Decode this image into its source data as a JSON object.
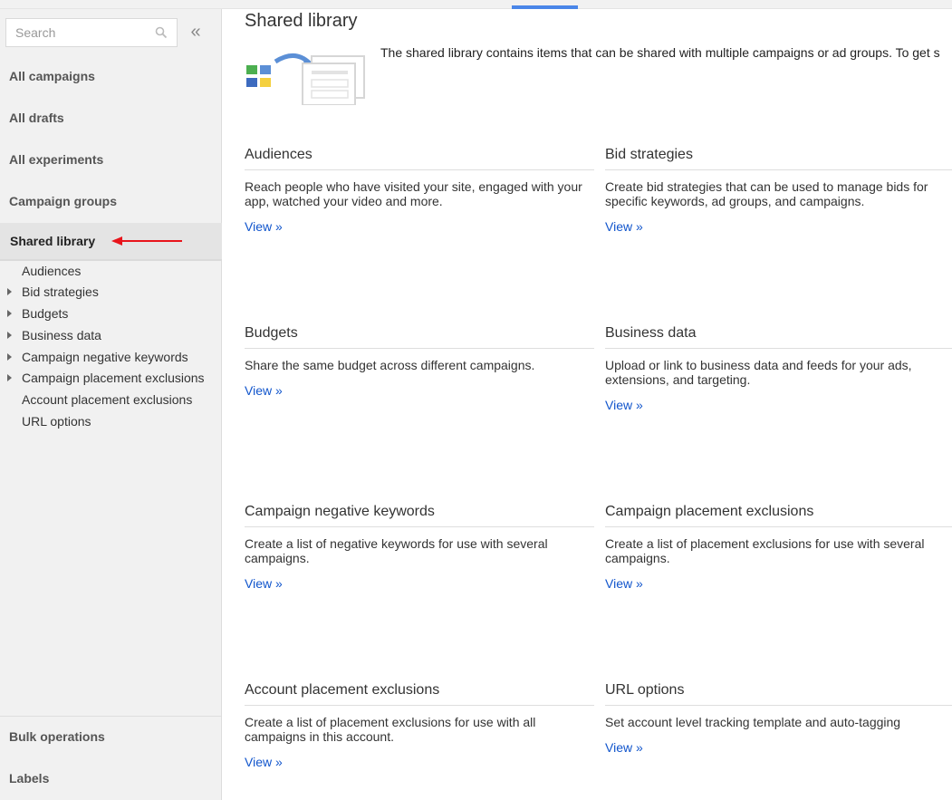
{
  "sidebar": {
    "search_placeholder": "Search",
    "collapse_label": "«",
    "nav": {
      "all_campaigns": "All campaigns",
      "all_drafts": "All drafts",
      "all_experiments": "All experiments",
      "campaign_groups": "Campaign groups",
      "shared_library": "Shared library",
      "bulk_operations": "Bulk operations",
      "labels": "Labels"
    },
    "sub_items": [
      {
        "label": "Audiences",
        "expandable": false
      },
      {
        "label": "Bid strategies",
        "expandable": true
      },
      {
        "label": "Budgets",
        "expandable": true
      },
      {
        "label": "Business data",
        "expandable": true
      },
      {
        "label": "Campaign negative keywords",
        "expandable": true
      },
      {
        "label": "Campaign placement exclusions",
        "expandable": true
      },
      {
        "label": "Account placement exclusions",
        "expandable": false
      },
      {
        "label": "URL options",
        "expandable": false
      }
    ]
  },
  "main": {
    "title": "Shared library",
    "intro": "The shared library contains items that can be shared with multiple campaigns or ad groups. To get s",
    "cards": [
      {
        "title": "Audiences",
        "desc": "Reach people who have visited your site, engaged with your app, watched your video and more.",
        "link": "View »"
      },
      {
        "title": "Bid strategies",
        "desc": "Create bid strategies that can be used to manage bids for specific keywords, ad groups, and campaigns.",
        "link": "View »"
      },
      {
        "title": "Budgets",
        "desc": "Share the same budget across different campaigns.",
        "link": "View »"
      },
      {
        "title": "Business data",
        "desc": "Upload or link to business data and feeds for your ads, extensions, and targeting.",
        "link": "View »"
      },
      {
        "title": "Campaign negative keywords",
        "desc": "Create a list of negative keywords for use with several campaigns.",
        "link": "View »"
      },
      {
        "title": "Campaign placement exclusions",
        "desc": "Create a list of placement exclusions for use with several campaigns.",
        "link": "View »"
      },
      {
        "title": "Account placement exclusions",
        "desc": "Create a list of placement exclusions for use with all campaigns in this account.",
        "link": "View »"
      },
      {
        "title": "URL options",
        "desc": "Set account level tracking template and auto-tagging",
        "link": "View »"
      }
    ]
  },
  "colors": {
    "link": "#1155cc",
    "active_tab": "#4a86e8",
    "annotation_arrow": "#e8141b",
    "sidebar_bg": "#f1f1f1"
  }
}
